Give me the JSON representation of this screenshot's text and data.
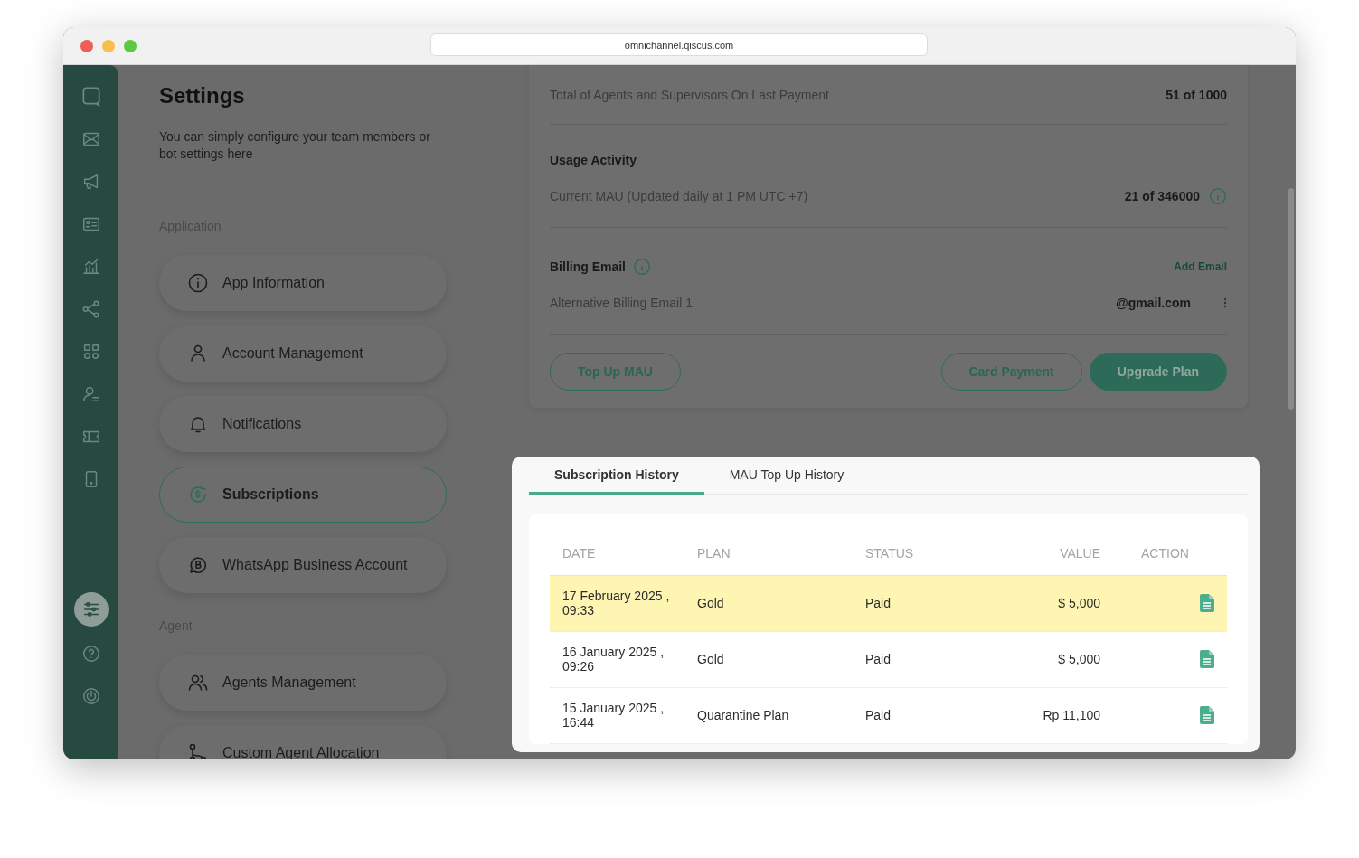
{
  "browser": {
    "url": "omnichannel.qiscus.com"
  },
  "rail": {
    "items": [
      {
        "selected": false
      },
      {
        "selected": false
      },
      {
        "selected": false
      },
      {
        "selected": false
      },
      {
        "selected": false
      },
      {
        "selected": false
      },
      {
        "selected": false
      },
      {
        "selected": false
      },
      {
        "selected": false
      },
      {
        "selected": false
      }
    ],
    "bottom": [
      {
        "selected": true
      },
      {
        "selected": false
      },
      {
        "selected": false
      }
    ]
  },
  "settings": {
    "title": "Settings",
    "description": "You can simply configure your team members or bot settings here",
    "sections": [
      {
        "label": "Application",
        "items": [
          {
            "label": "App Information",
            "selected": false
          },
          {
            "label": "Account Management",
            "selected": false
          },
          {
            "label": "Notifications",
            "selected": false
          },
          {
            "label": "Subscriptions",
            "selected": true
          },
          {
            "label": "WhatsApp Business Account",
            "selected": false
          }
        ]
      },
      {
        "label": "Agent",
        "items": [
          {
            "label": "Agents Management",
            "selected": false
          },
          {
            "label": "Custom Agent Allocation",
            "selected": false
          }
        ]
      }
    ]
  },
  "plan_card": {
    "rows": [
      {
        "label": "Total of Agents and Supervisors On Last Payment",
        "value": "51 of 1000"
      }
    ],
    "usage": {
      "heading": "Usage Activity",
      "rows": [
        {
          "label": "Current MAU (Updated daily at 1 PM UTC +7)",
          "value": "21 of 346000"
        }
      ]
    },
    "billing_email": {
      "heading": "Billing Email",
      "add_link": "Add Email",
      "rows": [
        {
          "label": "Alternative Billing Email 1",
          "value": "@gmail.com"
        }
      ]
    },
    "buttons": [
      {
        "label": "Top Up MAU",
        "kind": "outline"
      },
      {
        "label": "Card Payment",
        "kind": "outline"
      },
      {
        "label": "Upgrade Plan",
        "kind": "primary"
      }
    ]
  },
  "history": {
    "tabs": [
      {
        "label": "Subscription History",
        "selected": true
      },
      {
        "label": "MAU Top Up History",
        "selected": false
      }
    ],
    "columns": [
      "DATE",
      "PLAN",
      "STATUS",
      "VALUE",
      "ACTION"
    ],
    "rows": [
      {
        "date": "17 February 2025 ,",
        "time": "09:33",
        "plan": "Gold",
        "status": "Paid",
        "value": "$ 5,000",
        "selected": true
      },
      {
        "date": "16 January 2025 ,",
        "time": "09:26",
        "plan": "Gold",
        "status": "Paid",
        "value": "$ 5,000",
        "selected": false
      },
      {
        "date": "15 January 2025 ,",
        "time": "16:44",
        "plan": "Quarantine Plan",
        "status": "Paid",
        "value": "Rp 11,100",
        "selected": false
      }
    ]
  }
}
